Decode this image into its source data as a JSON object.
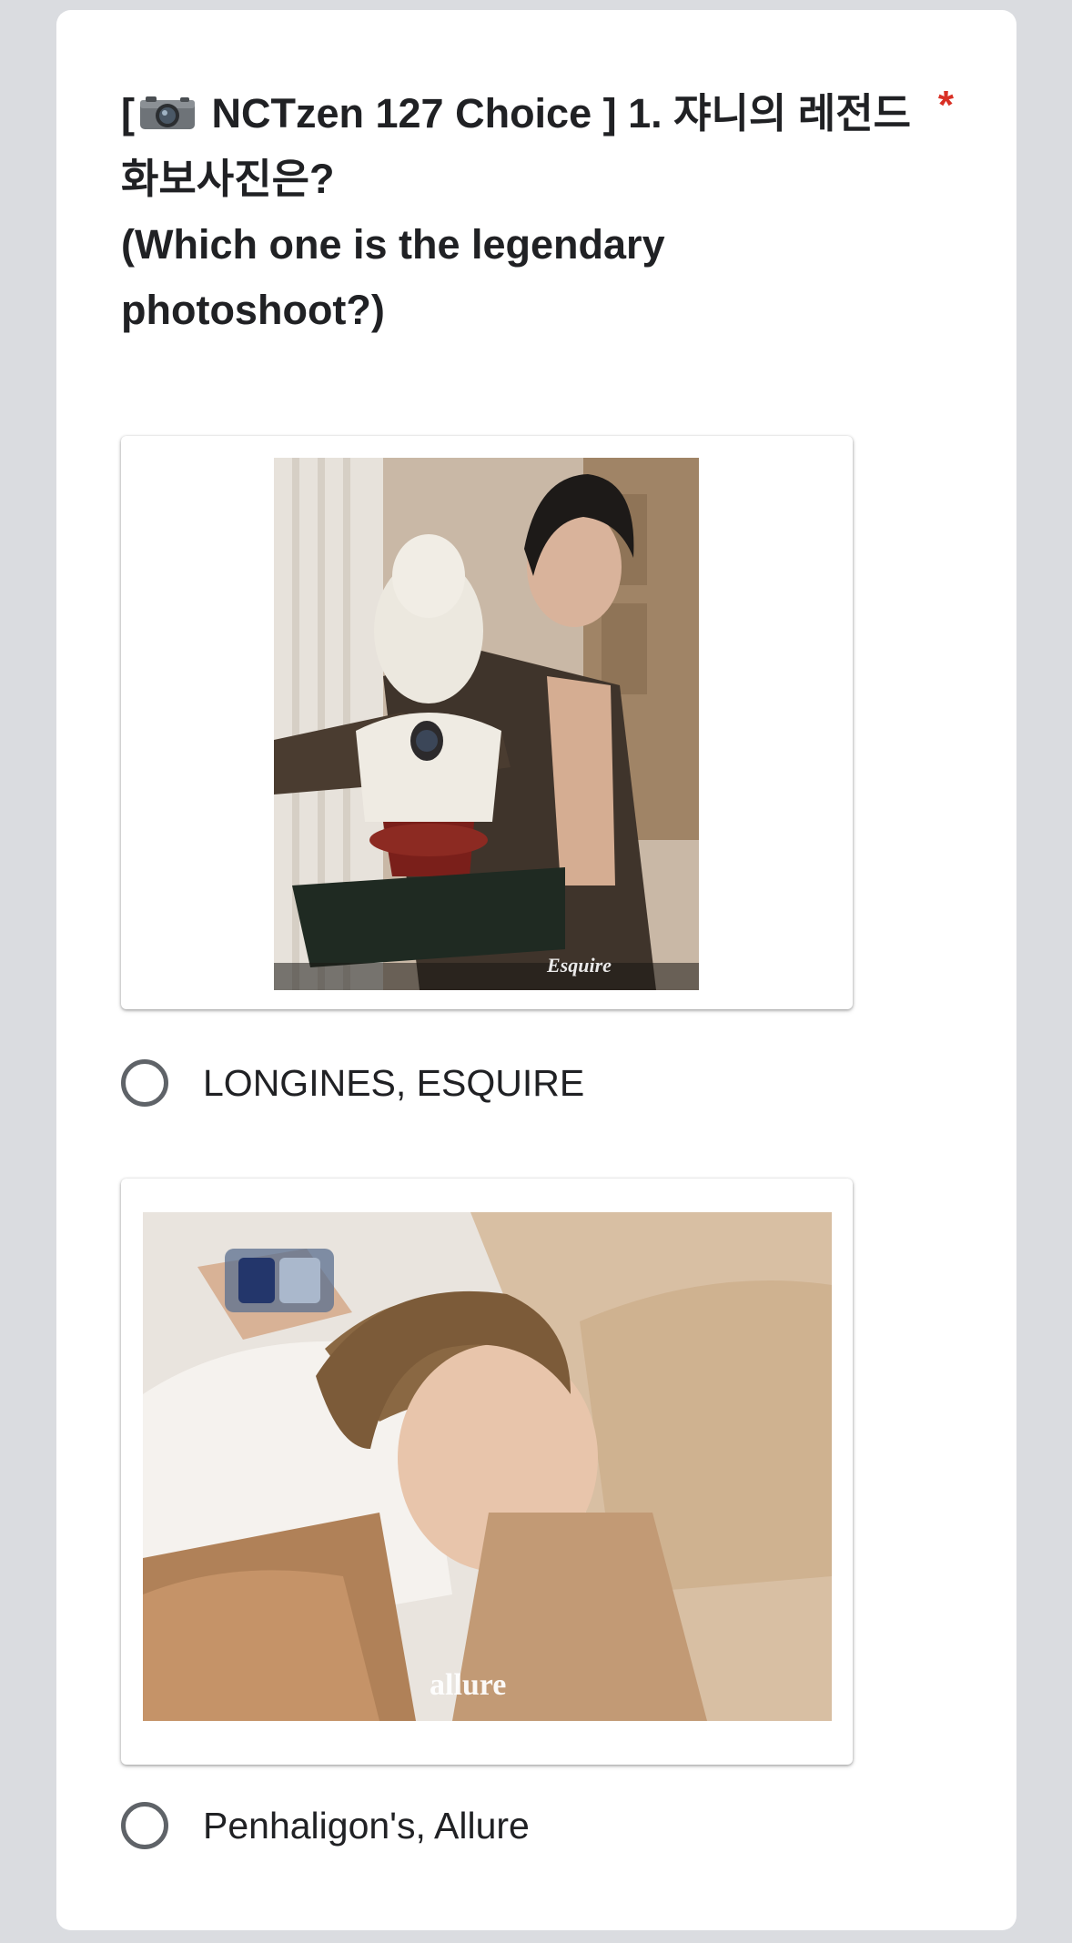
{
  "question": {
    "line1_before_icon": "[",
    "camera_icon": "camera-emoji-icon",
    "line1_after_icon": " NCTzen 127 Choice ] 1. 쟈니의 레전드",
    "line2": "화보사진은?",
    "line3": "(Which one is the legendary",
    "line4": "photoshoot?)",
    "required_mark": "*"
  },
  "options": [
    {
      "image_watermark": "Esquire",
      "label": "LONGINES, ESQUIRE"
    },
    {
      "image_watermark": "allure",
      "label": "Penhaligon's, Allure"
    }
  ],
  "colors": {
    "background": "#dadce0",
    "card": "#ffffff",
    "required": "#d93025",
    "radio_border": "#5f6368",
    "text": "#202124"
  }
}
